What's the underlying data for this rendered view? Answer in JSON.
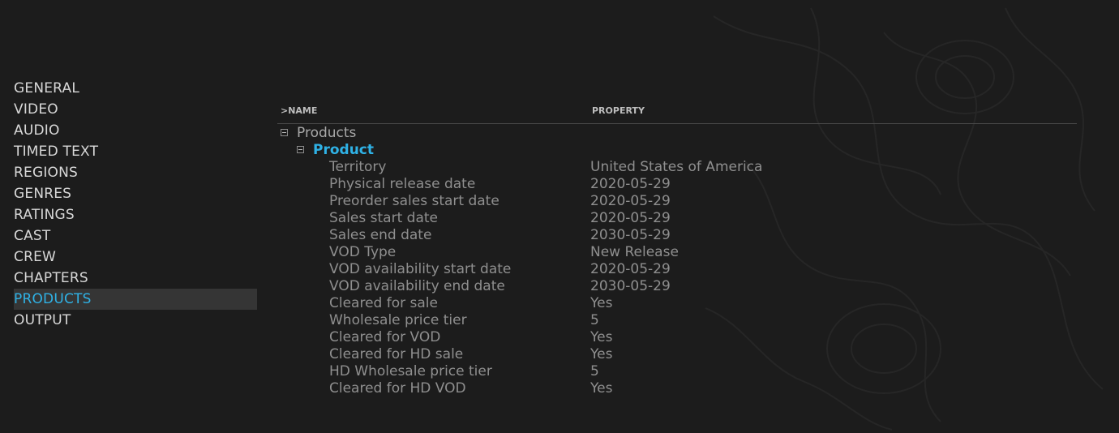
{
  "sidebar": {
    "items": [
      {
        "label": "GENERAL"
      },
      {
        "label": "VIDEO"
      },
      {
        "label": "AUDIO"
      },
      {
        "label": "TIMED TEXT"
      },
      {
        "label": "REGIONS"
      },
      {
        "label": "GENRES"
      },
      {
        "label": "RATINGS"
      },
      {
        "label": "CAST"
      },
      {
        "label": "CREW"
      },
      {
        "label": "CHAPTERS"
      },
      {
        "label": "PRODUCTS"
      },
      {
        "label": "OUTPUT"
      }
    ],
    "active": "PRODUCTS"
  },
  "tree": {
    "headers": {
      "name": ">NAME",
      "property": "PROPERTY"
    },
    "root": {
      "label": "Products"
    },
    "product": {
      "label": "Product"
    },
    "properties": [
      {
        "name": "Territory",
        "value": "United States of America"
      },
      {
        "name": "Physical release date",
        "value": "2020-05-29"
      },
      {
        "name": "Preorder sales start date",
        "value": "2020-05-29"
      },
      {
        "name": "Sales start date",
        "value": "2020-05-29"
      },
      {
        "name": "Sales end date",
        "value": "2030-05-29"
      },
      {
        "name": "VOD Type",
        "value": "New Release"
      },
      {
        "name": "VOD availability start date",
        "value": "2020-05-29"
      },
      {
        "name": "VOD availability end date",
        "value": "2030-05-29"
      },
      {
        "name": "Cleared for sale",
        "value": "Yes"
      },
      {
        "name": "Wholesale price tier",
        "value": "5"
      },
      {
        "name": "Cleared for VOD",
        "value": "Yes"
      },
      {
        "name": "Cleared for HD sale",
        "value": "Yes"
      },
      {
        "name": "HD Wholesale price tier",
        "value": "5"
      },
      {
        "name": "Cleared for HD VOD",
        "value": "Yes"
      }
    ]
  },
  "colors": {
    "background": "#1c1c1c",
    "accent": "#2fb2e6",
    "active_row": "#353535",
    "text": "#d6d6d6",
    "muted_text": "#8f8f8f"
  }
}
